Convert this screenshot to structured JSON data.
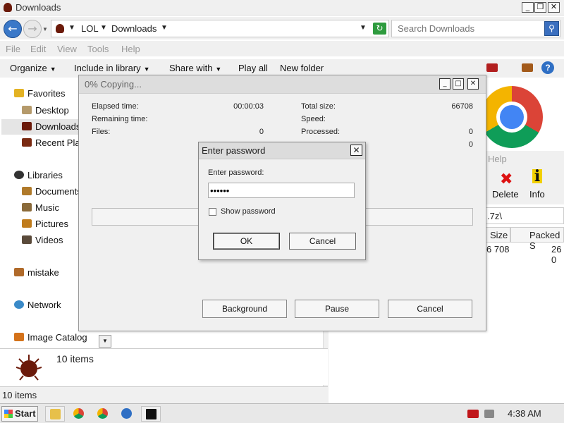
{
  "window": {
    "title": "Downloads",
    "minimize_icon": "_",
    "maximize_icon": "❐",
    "close_icon": "✕"
  },
  "address": {
    "crumbs": [
      "LOL",
      "Downloads"
    ],
    "search_placeholder": "Search Downloads"
  },
  "menu": [
    "File",
    "Edit",
    "View",
    "Tools",
    "Help"
  ],
  "toolbar": {
    "organize": "Organize",
    "include": "Include in library",
    "share": "Share with",
    "play_all": "Play all",
    "new_folder": "New folder"
  },
  "navpane": {
    "favorites": "Favorites",
    "desktop": "Desktop",
    "downloads": "Downloads",
    "recent": "Recent Places",
    "libraries": "Libraries",
    "documents": "Documents",
    "music": "Music",
    "pictures": "Pictures",
    "videos": "Videos",
    "mistake": "mistake",
    "network": "Network",
    "image_catalog": "Image Catalog"
  },
  "folder": {
    "count": "10 items",
    "status": "10 items"
  },
  "fm": {
    "menu_help": "Help",
    "delete": "Delete",
    "info": "Info",
    "path": ".7z\\",
    "col_size": "Size",
    "col_packed": "Packed S",
    "row_size": "6 708",
    "row_packed": "26 0"
  },
  "copy_dialog": {
    "title": "0% Copying...",
    "elapsed_label": "Elapsed time:",
    "elapsed_value": "00:00:03",
    "remaining_label": "Remaining time:",
    "files_label": "Files:",
    "files_value": "0",
    "total_label": "Total size:",
    "total_value": "66708",
    "speed_label": "Speed:",
    "processed_label": "Processed:",
    "processed_value": "0",
    "extra_value": "0",
    "progress": 0,
    "background": "Background",
    "pause": "Pause",
    "cancel": "Cancel"
  },
  "password_dialog": {
    "title": "Enter password",
    "label": "Enter password:",
    "value": "••••••",
    "show_password": "Show password",
    "ok": "OK",
    "cancel": "Cancel"
  },
  "taskbar": {
    "start": "Start",
    "clock": "4:38 AM"
  }
}
